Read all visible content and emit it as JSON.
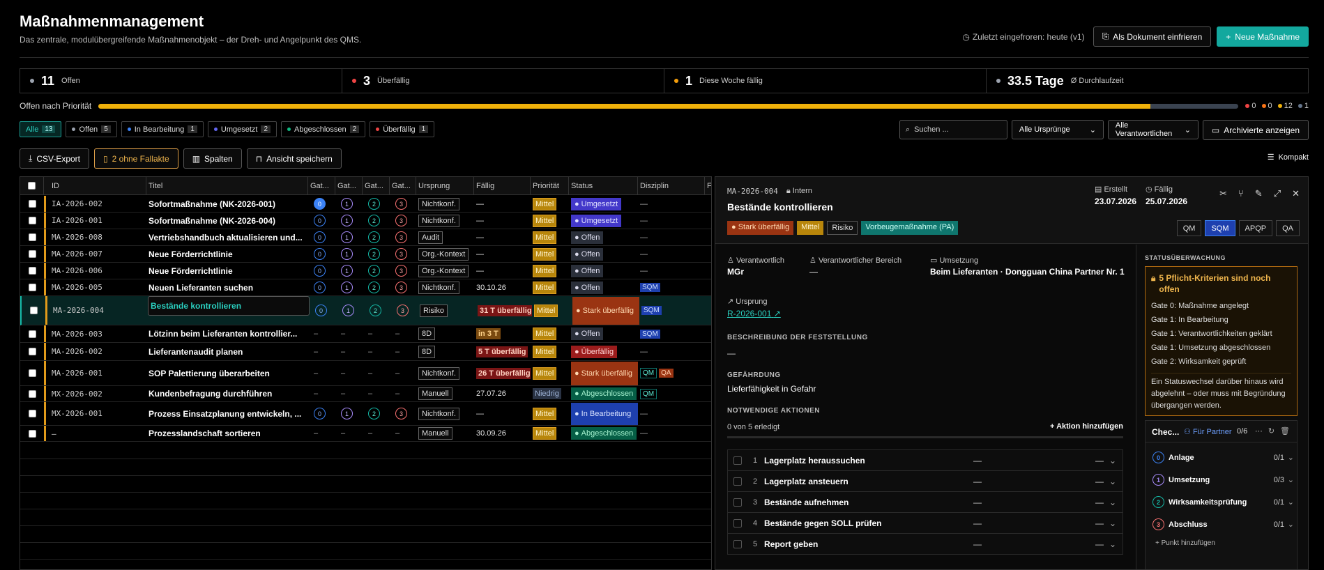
{
  "header": {
    "title": "Maßnahmenmanagement",
    "subtitle": "Das zentrale, modulübergreifende Maßnahmenobjekt – der Dreh- und Angelpunkt des QMS.",
    "frozen": "Zuletzt eingefroren: heute (v1)",
    "freeze_button": "Als Dokument einfrieren",
    "new_button": "Neue Maßnahme"
  },
  "stats": [
    {
      "value": "11",
      "label": "Offen",
      "color": "#9ca3af"
    },
    {
      "value": "3",
      "label": "Überfällig",
      "color": "#ef4444"
    },
    {
      "value": "1",
      "label": "Diese Woche fällig",
      "color": "#f59e0b"
    },
    {
      "value": "33.5 Tage",
      "label": "Ø Durchlaufzeit",
      "color": "#9ca3af"
    }
  ],
  "priority": {
    "label": "Offen nach Priorität",
    "fill_fraction": 0.923,
    "legend": [
      {
        "value": "0",
        "color": "#ef4444"
      },
      {
        "value": "0",
        "color": "#f97316"
      },
      {
        "value": "12",
        "color": "#f0b10a"
      },
      {
        "value": "1",
        "color": "#64748b"
      }
    ]
  },
  "filters": [
    {
      "label": "Alle",
      "count": "13",
      "dot": ""
    },
    {
      "label": "Offen",
      "count": "5",
      "dot": "#9ca3af"
    },
    {
      "label": "In Bearbeitung",
      "count": "1",
      "dot": "#3b82f6"
    },
    {
      "label": "Umgesetzt",
      "count": "2",
      "dot": "#6366f1"
    },
    {
      "label": "Abgeschlossen",
      "count": "2",
      "dot": "#10b981"
    },
    {
      "label": "Überfällig",
      "count": "1",
      "dot": "#ef4444"
    }
  ],
  "search": {
    "placeholder": "Suchen ..."
  },
  "selects": {
    "origin": "Alle Ursprünge",
    "owner": "Alle Verantwortlichen",
    "archived": "Archivierte anzeigen"
  },
  "tools": {
    "csv": "CSV-Export",
    "missing": "2 ohne Fallakte",
    "columns": "Spalten",
    "save": "Ansicht speichern",
    "compact": "Kompakt"
  },
  "columns": {
    "id": "ID",
    "title": "Titel",
    "g0": "Gat...",
    "g1": "Gat...",
    "g2": "Gat...",
    "g3": "Gat...",
    "origin": "Ursprung",
    "due": "Fällig",
    "priority": "Priorität",
    "status": "Status",
    "discipline": "Disziplin",
    "more": "F"
  },
  "rows": [
    {
      "id": "IA-2026-002",
      "title": "Sofortmaßnahme (NK-2026-001)",
      "gates": true,
      "g0on": true,
      "origin": "Nichtkonf.",
      "due": "—",
      "dueType": "",
      "prio": "Mittel",
      "status": "Umgesetzt",
      "statusType": "ums",
      "disc": []
    },
    {
      "id": "IA-2026-001",
      "title": "Sofortmaßnahme (NK-2026-004)",
      "gates": true,
      "origin": "Nichtkonf.",
      "due": "—",
      "dueType": "",
      "prio": "Mittel",
      "status": "Umgesetzt",
      "statusType": "ums",
      "disc": []
    },
    {
      "id": "MA-2026-008",
      "title": "Vertriebshandbuch aktualisieren und...",
      "gates": true,
      "origin": "Audit",
      "due": "—",
      "dueType": "",
      "prio": "Mittel",
      "status": "Offen",
      "statusType": "off",
      "disc": []
    },
    {
      "id": "MA-2026-007",
      "title": "Neue Förderrichtlinie",
      "gates": true,
      "origin": "Org.-Kontext",
      "due": "—",
      "dueType": "",
      "prio": "Mittel",
      "status": "Offen",
      "statusType": "off",
      "disc": []
    },
    {
      "id": "MA-2026-006",
      "title": "Neue Förderrichtlinie",
      "gates": true,
      "origin": "Org.-Kontext",
      "due": "—",
      "dueType": "",
      "prio": "Mittel",
      "status": "Offen",
      "statusType": "off",
      "disc": []
    },
    {
      "id": "MA-2026-005",
      "title": "Neuen Lieferanten suchen",
      "gates": true,
      "origin": "Nichtkonf.",
      "due": "30.10.26",
      "dueType": "",
      "prio": "Mittel",
      "status": "Offen",
      "statusType": "off",
      "disc": [
        "SQM"
      ]
    },
    {
      "id": "MA-2026-004",
      "title": "Bestände kontrollieren",
      "gates": true,
      "selected": true,
      "origin": "Risiko",
      "due": "31 T überfällig",
      "dueType": "red",
      "prio": "Mittel",
      "status": "Stark überfällig",
      "statusType": "stark",
      "disc": [
        "SQM"
      ]
    },
    {
      "id": "MA-2026-003",
      "title": "Lötzinn beim Lieferanten kontrollier...",
      "gates": false,
      "origin": "8D",
      "due": "in 3 T",
      "dueType": "org",
      "prio": "Mittel",
      "status": "Offen",
      "statusType": "off",
      "disc": [
        "SQM"
      ]
    },
    {
      "id": "MA-2026-002",
      "title": "Lieferantenaudit planen",
      "gates": false,
      "origin": "8D",
      "due": "5 T überfällig",
      "dueType": "red",
      "prio": "Mittel",
      "status": "Überfällig",
      "statusType": "uber",
      "disc": []
    },
    {
      "id": "MA-2026-001",
      "title": "SOP Palettierung überarbeiten",
      "gates": false,
      "origin": "Nichtkonf.",
      "due": "26 T überfällig",
      "dueType": "red",
      "prio": "Mittel",
      "status": "Stark überfällig",
      "statusType": "stark",
      "disc": [
        "QM",
        "QA"
      ]
    },
    {
      "id": "MX-2026-002",
      "title": "Kundenbefragung durchführen",
      "gates": false,
      "origin": "Manuell",
      "due": "27.07.26",
      "dueType": "",
      "prio": "Niedrig",
      "status": "Abgeschlossen",
      "statusType": "abg",
      "disc": [
        "QM"
      ]
    },
    {
      "id": "MX-2026-001",
      "title": "Prozess Einsatzplanung entwickeln, ...",
      "gates": true,
      "origin": "Nichtkonf.",
      "due": "—",
      "dueType": "",
      "prio": "Mittel",
      "status": "In Bearbeitung",
      "statusType": "inb",
      "disc": []
    },
    {
      "id": "–",
      "title": "Prozesslandschaft sortieren",
      "gates": false,
      "origin": "Manuell",
      "due": "30.09.26",
      "dueType": "",
      "prio": "Mittel",
      "status": "Abgeschlossen",
      "statusType": "abg",
      "disc": []
    }
  ],
  "gate_labels": [
    "0",
    "1",
    "2",
    "3"
  ],
  "detail": {
    "id": "MA-2026-004",
    "visibility": "Intern",
    "title": "Bestände kontrollieren",
    "created_label": "Erstellt",
    "created": "23.07.2026",
    "due_label": "Fällig",
    "due": "25.07.2026",
    "tags": [
      "Stark überfällig",
      "Mittel",
      "Risiko",
      "Vorbeugemaßnahme (PA)"
    ],
    "disciplines": [
      "QM",
      "SQM",
      "APQP",
      "QA"
    ],
    "owner_label": "Verantwortlich",
    "owner": "MGr",
    "area_label": "Verantwortlicher Bereich",
    "area": "—",
    "impl_label": "Umsetzung",
    "impl": "Beim Lieferanten · Dongguan China Partner Nr. 1",
    "origin_label": "Ursprung",
    "origin": "R-2026-001",
    "desc_label": "BESCHREIBUNG DER FESTSTELLUNG",
    "desc": "—",
    "risk_label": "GEFÄHRDUNG",
    "risk": "Lieferfähigkeit in Gefahr",
    "actions_label": "NOTWENDIGE AKTIONEN",
    "actions_done": "0 von 5 erledigt",
    "add_action": "Aktion hinzufügen",
    "actions": [
      {
        "n": "1",
        "t": "Lagerplatz heraussuchen",
        "a": "—",
        "b": "—"
      },
      {
        "n": "2",
        "t": "Lagerplatz ansteuern",
        "a": "—",
        "b": "—"
      },
      {
        "n": "3",
        "t": "Bestände aufnehmen",
        "a": "—",
        "b": "—"
      },
      {
        "n": "4",
        "t": "Bestände gegen SOLL prüfen",
        "a": "—",
        "b": "—"
      },
      {
        "n": "5",
        "t": "Report geben",
        "a": "—",
        "b": "—"
      }
    ],
    "monitor_label": "STATUSÜBERWACHUNG",
    "warn_title": "5 Pflicht-Kriterien sind noch offen",
    "warn_items": [
      "Gate 0: Maßnahme angelegt",
      "Gate 1: In Bearbeitung",
      "Gate 1: Verantwortlichkeiten geklärt",
      "Gate 1: Umsetzung abgeschlossen",
      "Gate 2: Wirksamkeit geprüft"
    ],
    "warn_note": "Ein Statuswechsel darüber hinaus wird abgelehnt – oder muss mit Begründung übergangen werden.",
    "checklist_label": "Chec...",
    "partner": "Für Partner",
    "partner_count": "0/6",
    "gates": [
      {
        "n": "0",
        "t": "Anlage",
        "c": "0/1"
      },
      {
        "n": "1",
        "t": "Umsetzung",
        "c": "0/3"
      },
      {
        "n": "2",
        "t": "Wirksamkeitsprüfung",
        "c": "0/1"
      },
      {
        "n": "3",
        "t": "Abschluss",
        "c": "0/1"
      }
    ],
    "add_point": "Punkt hinzufügen"
  }
}
